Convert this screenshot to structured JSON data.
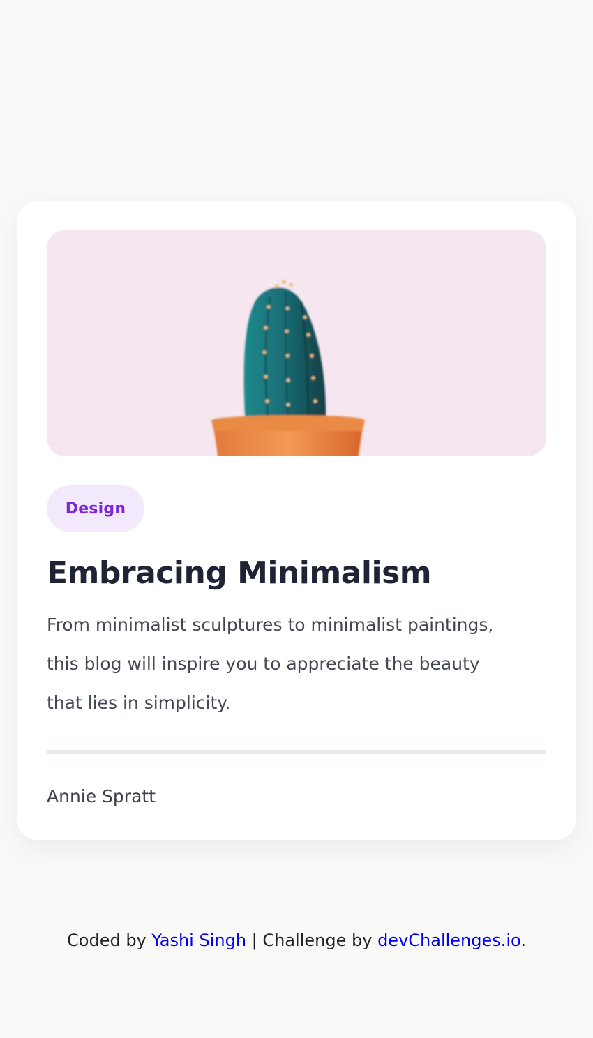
{
  "card": {
    "image": {
      "description_icon": "cactus-image"
    },
    "tag": "Design",
    "title": "Embracing Minimalism",
    "description": "From minimalist sculptures to minimalist paintings, this blog will inspire you to appreciate the beauty that lies in simplicity.",
    "author": "Annie Spratt"
  },
  "footer": {
    "prefix": "Coded by ",
    "author_link": "Yashi Singh",
    "middle": " | Challenge by ",
    "challenge_link": "devChallenges.io",
    "suffix": "."
  },
  "colors": {
    "background": "#f9f9f8",
    "card": "#ffffff",
    "hero_bg": "#f6e6f0",
    "tag_bg": "#f2eafc",
    "tag_text": "#7b24d8",
    "title": "#1e2434",
    "body_text": "#444754",
    "divider": "#e6e9ef",
    "link": "#0000ee"
  }
}
